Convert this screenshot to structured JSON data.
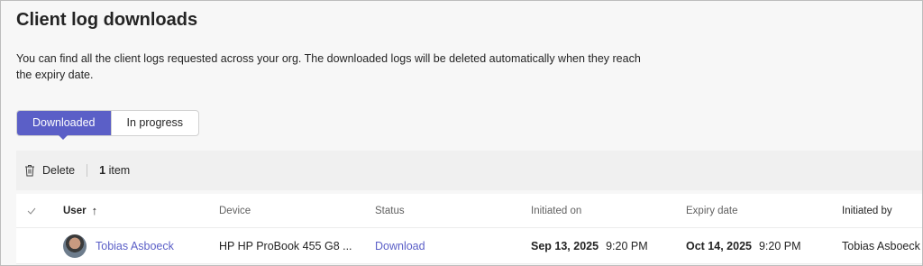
{
  "page": {
    "title": "Client log downloads",
    "description": "You can find all the client logs requested across your org. The downloaded logs will be deleted automatically when they reach the expiry date."
  },
  "tabs": [
    {
      "label": "Downloaded",
      "active": true
    },
    {
      "label": "In progress",
      "active": false
    }
  ],
  "toolbar": {
    "delete_label": "Delete",
    "count_value": "1",
    "count_unit": "item"
  },
  "table": {
    "columns": {
      "user": "User",
      "device": "Device",
      "status": "Status",
      "initiated_on": "Initiated on",
      "expiry_date": "Expiry date",
      "initiated_by": "Initiated by"
    },
    "sort_indicator": "↑",
    "rows": [
      {
        "user": "Tobias Asboeck",
        "device": "HP HP ProBook 455 G8 ...",
        "status": "Download",
        "initiated_on_date": "Sep 13, 2025",
        "initiated_on_time": "9:20 PM",
        "expiry_date": "Oct 14, 2025",
        "expiry_time": "9:20 PM",
        "initiated_by": "Tobias Asboeck"
      }
    ]
  },
  "colors": {
    "accent": "#5b5fc7",
    "text": "#242424",
    "muted": "#616161",
    "background": "#f7f7f7"
  },
  "icons": {
    "delete": "trash-icon",
    "select_all": "checkmark-icon",
    "sort": "arrow-up-icon"
  }
}
